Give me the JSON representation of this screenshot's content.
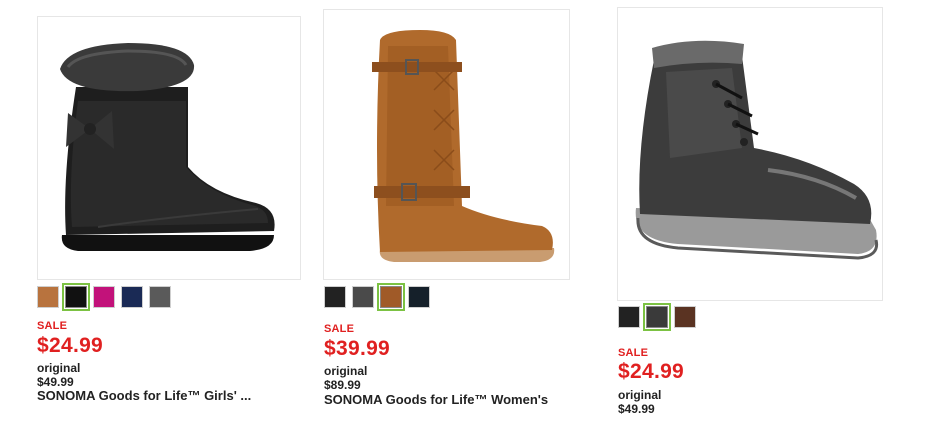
{
  "products": [
    {
      "sale_label": "SALE",
      "price": "$24.99",
      "original": "original $49.99",
      "title": "SONOMA Goods for Life™ Girls' ...",
      "image_icon": "black-boot-image",
      "swatches": [
        {
          "color": "#b8733e",
          "selected": false
        },
        {
          "color": "#111111",
          "selected": true
        },
        {
          "color": "#c2127a",
          "selected": false
        },
        {
          "color": "#1a2a55",
          "selected": false
        },
        {
          "color": "#5a5a5a",
          "selected": false
        }
      ]
    },
    {
      "sale_label": "SALE",
      "price": "$39.99",
      "original": "original $89.99",
      "title": "SONOMA Goods for Life™ Women's",
      "image_icon": "tan-tall-boot-image",
      "swatches": [
        {
          "color": "#222222",
          "selected": false
        },
        {
          "color": "#4a4a4a",
          "selected": false
        },
        {
          "color": "#a05a28",
          "selected": true
        },
        {
          "color": "#15202a",
          "selected": false
        }
      ]
    },
    {
      "sale_label": "SALE",
      "price": "$24.99",
      "original": "original $49.99",
      "title": "",
      "image_icon": "grey-lace-up-boot-image",
      "swatches": [
        {
          "color": "#222222",
          "selected": false
        },
        {
          "color": "#3a3a3a",
          "selected": true
        },
        {
          "color": "#5a3322",
          "selected": false
        }
      ]
    }
  ]
}
